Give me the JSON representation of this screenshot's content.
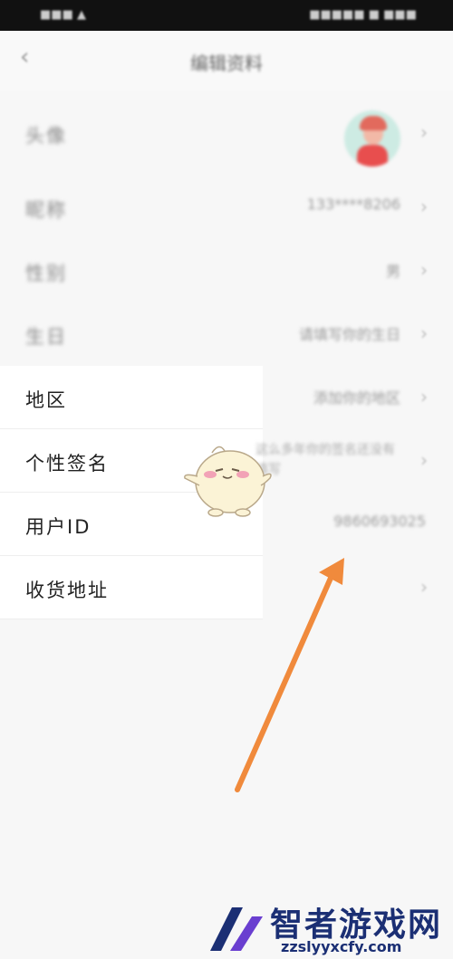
{
  "status_bar": {
    "left": "■■■ ▲",
    "right": "■■■■■ ■ ■■■"
  },
  "nav": {
    "back_icon": "chevron-left-icon",
    "title": "编辑资料"
  },
  "rows": [
    {
      "label": "头像",
      "value": "",
      "kind": "avatar"
    },
    {
      "label": "昵称",
      "value": "133****8206"
    },
    {
      "label": "性别",
      "value": "男"
    },
    {
      "label": "生日",
      "value": "请填写你的生日"
    },
    {
      "label": "地区",
      "value": "添加你的地区"
    },
    {
      "label": "个性签名",
      "value": "这么多年你的签名还没有填写"
    },
    {
      "label": "用户ID",
      "value": "9860693025"
    },
    {
      "label": "收货地址",
      "value": ""
    }
  ],
  "watermark": {
    "brand": "智者游戏网",
    "url": "zzslyyxcfy.com"
  },
  "colors": {
    "arrow": "#f08a3c",
    "brand": "#1b2f74"
  }
}
